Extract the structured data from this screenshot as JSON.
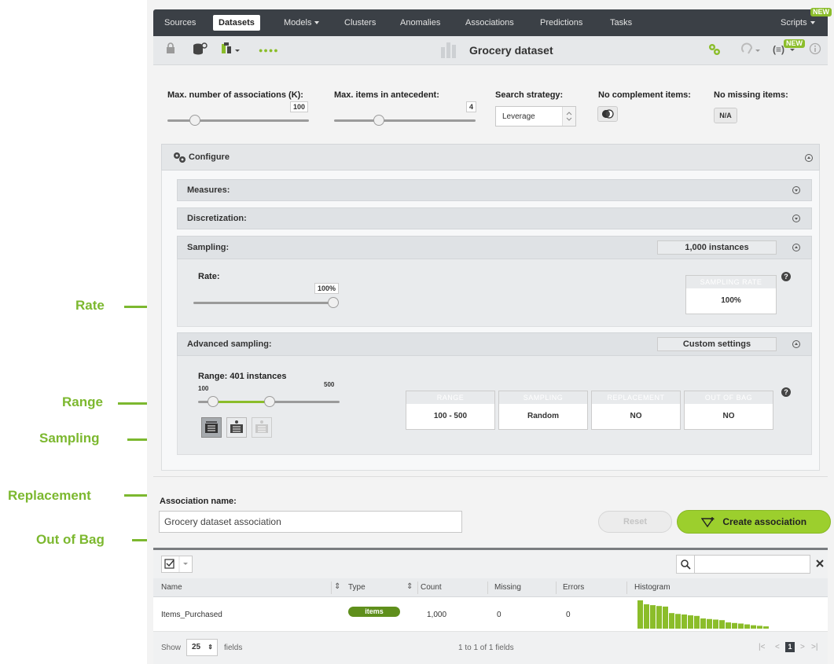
{
  "nav": {
    "items": [
      {
        "label": "Sources"
      },
      {
        "label": "Datasets"
      },
      {
        "label": "Models"
      },
      {
        "label": "Clusters"
      },
      {
        "label": "Anomalies"
      },
      {
        "label": "Associations"
      },
      {
        "label": "Predictions"
      },
      {
        "label": "Tasks"
      }
    ],
    "scripts_label": "Scripts",
    "new_badge": "NEW"
  },
  "toolbar": {
    "dataset_title": "Grocery dataset",
    "dots": "●●●●",
    "new_badge": "NEW"
  },
  "params": {
    "max_assoc_label": "Max. number of associations (K):",
    "max_assoc_value": "100",
    "max_assoc_level": 0.1,
    "max_items_label": "Max. items in antecedent:",
    "max_items_value": "4",
    "max_items_level": 0.3,
    "search_label": "Search strategy:",
    "search_value": "Leverage",
    "no_complement_label": "No complement items:",
    "no_missing_label": "No missing items:",
    "na_label": "N/A"
  },
  "configure": {
    "title": "Configure",
    "measures": "Measures:",
    "discretization": "Discretization:",
    "sampling": "Sampling:",
    "sampling_summary": "1,000 instances",
    "rate_label": "Rate:",
    "rate_value": "100%",
    "rate_level": 1.0,
    "sampling_rate_head": "SAMPLING RATE",
    "sampling_rate_value": "100%",
    "advanced_title": "Advanced sampling:",
    "advanced_summary": "Custom settings",
    "range_label": "Range: 401 instances",
    "range_min": "100",
    "range_max": "500",
    "cards": [
      {
        "head": "RANGE",
        "value": "100 - 500"
      },
      {
        "head": "SAMPLING",
        "value": "Random"
      },
      {
        "head": "REPLACEMENT",
        "value": "NO"
      },
      {
        "head": "OUT OF BAG",
        "value": "NO"
      }
    ],
    "help": "?"
  },
  "association": {
    "name_label": "Association name:",
    "name_value": "Grocery dataset association",
    "reset_label": "Reset",
    "create_label": "Create association"
  },
  "annotations": {
    "rate": "Rate",
    "range": "Range",
    "sampling": "Sampling",
    "replacement": "Replacement",
    "out_of_bag": "Out of Bag"
  },
  "table": {
    "headers": [
      "Name",
      "Type",
      "Count",
      "Missing",
      "Errors",
      "Histogram"
    ],
    "rows": [
      {
        "name": "Items_Purchased",
        "type": "items",
        "count": "1,000",
        "missing": "0",
        "errors": "0",
        "histogram": [
          1.0,
          0.86,
          0.83,
          0.8,
          0.78,
          0.55,
          0.52,
          0.5,
          0.47,
          0.45,
          0.36,
          0.34,
          0.32,
          0.3,
          0.22,
          0.2,
          0.18,
          0.15,
          0.12,
          0.1,
          0.08
        ]
      }
    ],
    "show_label": "Show",
    "page_size": "25",
    "fields_label": "fields",
    "pagination_info": "1 to 1 of 1 fields",
    "current_page": "1",
    "accent": "#8bbd2a"
  }
}
